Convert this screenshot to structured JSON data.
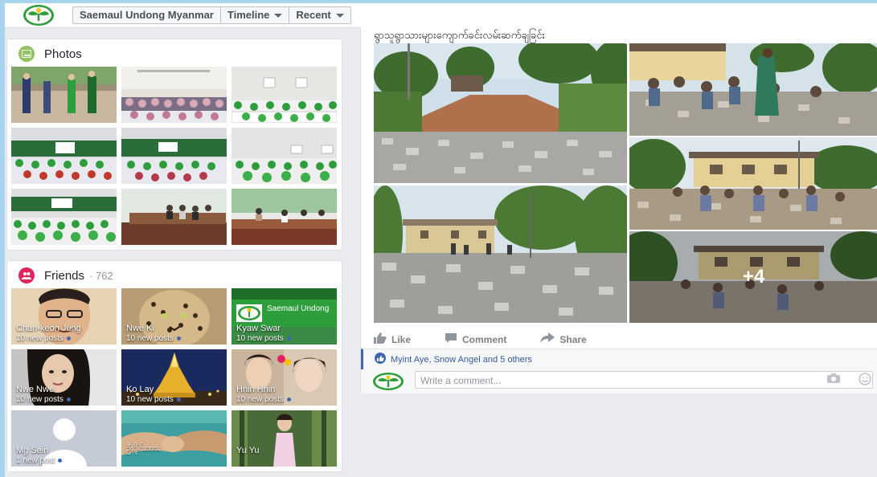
{
  "topbar": {
    "crumbs": [
      "Saemaul Undong Myanmar",
      "Timeline",
      "Recent"
    ]
  },
  "photos": {
    "title": "Photos",
    "items": [
      "p1",
      "p2",
      "p3",
      "p4",
      "p5",
      "p6",
      "p7",
      "p8",
      "p9"
    ]
  },
  "friends": {
    "title": "Friends",
    "count": "· 762",
    "items": [
      {
        "name": "Chan-keon Jung",
        "posts": "10 new posts"
      },
      {
        "name": "Nwe Ki",
        "posts": "10 new posts"
      },
      {
        "name": "Kyaw Swar",
        "posts": "10 new posts"
      },
      {
        "name": "Nwe Nwe",
        "posts": "10 new posts"
      },
      {
        "name": "Ko Lay",
        "posts": "10 new posts"
      },
      {
        "name": "Hnin Hnin",
        "posts": "10 new posts"
      },
      {
        "name": "Mg Sein",
        "posts": "1 new post"
      },
      {
        "name": "ဦးဝိုင်းထား",
        "posts": ""
      },
      {
        "name": "Yu Yu",
        "posts": ""
      }
    ],
    "card3_caption": "Saemaul Undong"
  },
  "post": {
    "title": "ရွာသူရွာသားများကျောက်ခင်းလမ်းဆက်ချခြင်း",
    "more_count": "+4",
    "actions": {
      "like": "Like",
      "comment": "Comment",
      "share": "Share"
    },
    "likes_text": "Myint Aye, Snow Angel and 5 others",
    "comment_placeholder": "Write a comment..."
  },
  "colors": {
    "fb_blue": "#4267b2",
    "link_blue": "#365899",
    "frame": "#a8d4f0",
    "photos_icon": "#8fc45f",
    "friends_icon": "#e0245e"
  },
  "icons": [
    "saemaul-logo-icon",
    "photos-icon",
    "friends-icon",
    "like-icon",
    "comment-icon",
    "share-icon",
    "camera-icon",
    "emoji-icon",
    "caret-down-icon"
  ]
}
